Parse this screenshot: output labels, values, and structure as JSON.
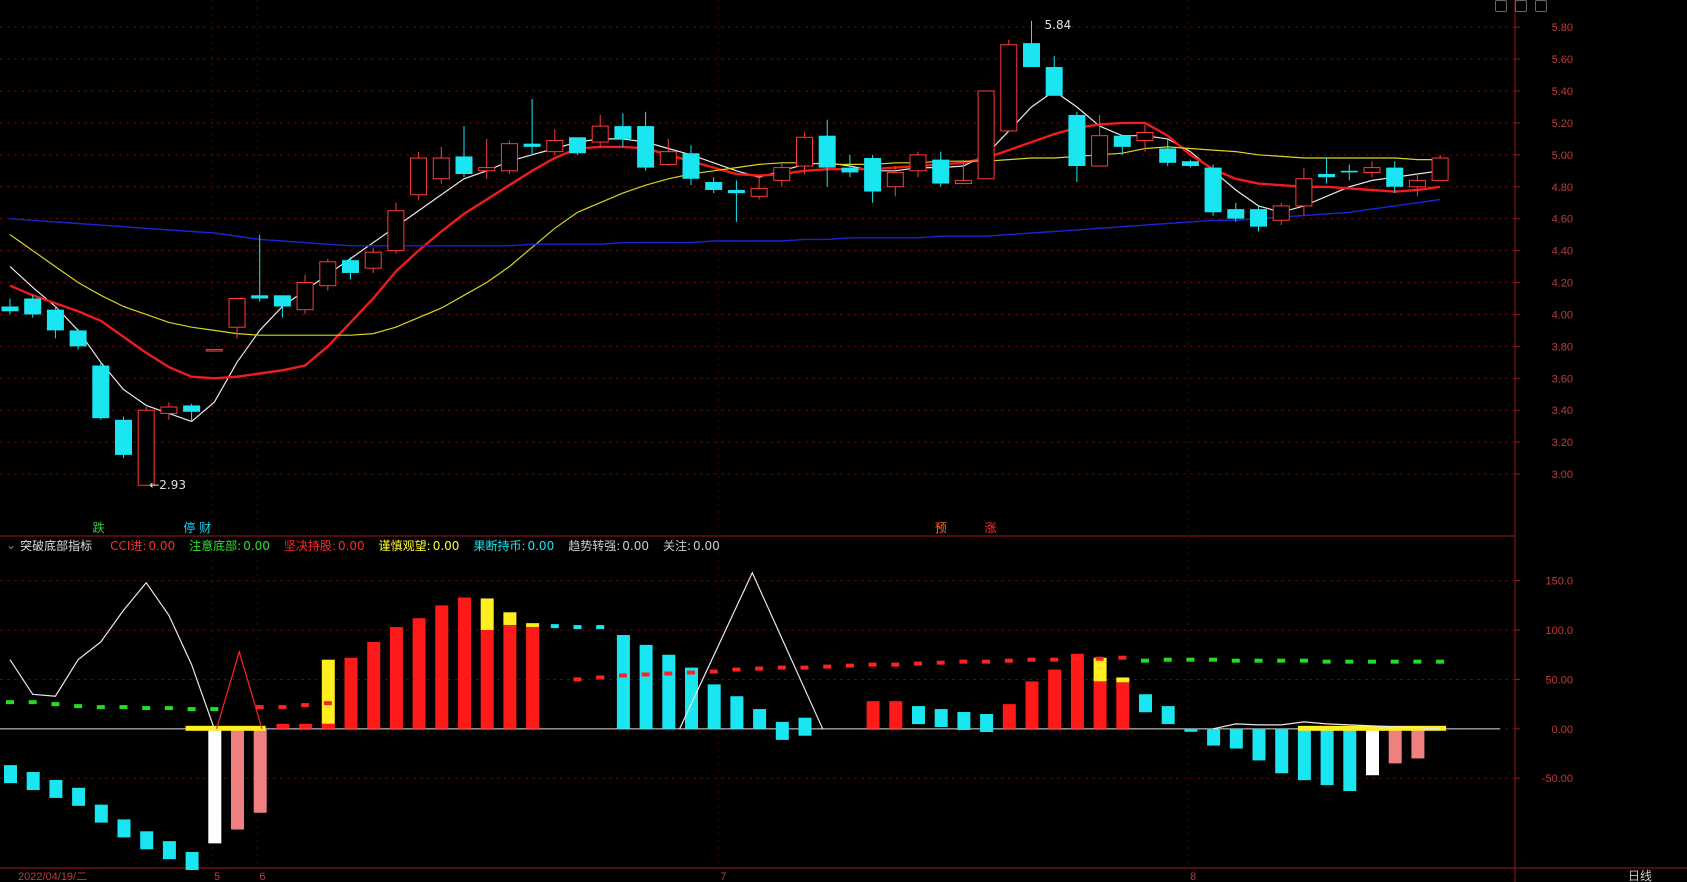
{
  "window": {
    "title_partial": ""
  },
  "period_label": "日线",
  "date_label": "2022/04/19/二",
  "month_ticks": [
    "5",
    "6",
    "7",
    "8"
  ],
  "price_axis": [
    "5.80",
    "5.60",
    "5.40",
    "5.20",
    "5.00",
    "4.80",
    "4.60",
    "4.40",
    "4.20",
    "4.00",
    "3.80",
    "3.60",
    "3.40",
    "3.20",
    "3.00"
  ],
  "indicator_axis": [
    "150.0",
    "100.0",
    "50.00",
    "0.00",
    "-50.00"
  ],
  "annotations": {
    "high": "5.84",
    "low": "←2.93"
  },
  "signals": [
    {
      "text": "跌",
      "color": "#2fd02f"
    },
    {
      "text": "停",
      "color": "#19d9f0"
    },
    {
      "text": "财",
      "color": "#19d9f0"
    },
    {
      "text": "预",
      "color": "#ff6a2a"
    },
    {
      "text": "涨",
      "color": "#ff3030"
    }
  ],
  "indicator": {
    "name": "突破底部指标",
    "fields": [
      {
        "label": "CCI进:",
        "value": "0.00",
        "color": "#ff2a2a"
      },
      {
        "label": "注意底部:",
        "value": "0.00",
        "color": "#2fe02f"
      },
      {
        "label": "坚决持股:",
        "value": "0.00",
        "color": "#ff2a2a"
      },
      {
        "label": "谨慎观望:",
        "value": "0.00",
        "color": "#ffff30"
      },
      {
        "label": "果断持币:",
        "value": "0.00",
        "color": "#19e6f0"
      },
      {
        "label": "趋势转强:",
        "value": "0.00",
        "color": "#cccccc"
      },
      {
        "label": "关注:",
        "value": "0.00",
        "color": "#cccccc"
      }
    ]
  },
  "colors": {
    "up": "#ff3b3b",
    "down": "#19e6f0",
    "ma_fast": "#e8e8e8",
    "ma_mid": "#ee1c1c",
    "ma_slow": "#d6d61e",
    "ma_long": "#1e22d0",
    "axis": "#a01818"
  },
  "chart_data": {
    "type": "candlestick",
    "ylim": [
      2.85,
      5.92
    ],
    "candles": [
      [
        4.05,
        4.02,
        4.1,
        4.0
      ],
      [
        4.1,
        4.0,
        4.12,
        3.98
      ],
      [
        4.03,
        3.9,
        4.05,
        3.85
      ],
      [
        3.9,
        3.8,
        3.91,
        3.78
      ],
      [
        3.68,
        3.35,
        3.7,
        3.34
      ],
      [
        3.34,
        3.12,
        3.36,
        3.1
      ],
      [
        2.93,
        3.4,
        3.42,
        2.93
      ],
      [
        3.38,
        3.42,
        3.45,
        3.34
      ],
      [
        3.43,
        3.39,
        3.44,
        3.33
      ],
      [
        3.78,
        3.78,
        3.78,
        3.78
      ],
      [
        3.92,
        4.1,
        4.1,
        3.85
      ],
      [
        4.12,
        4.1,
        4.5,
        4.08
      ],
      [
        4.12,
        4.05,
        4.12,
        3.98
      ],
      [
        4.03,
        4.2,
        4.25,
        4.0
      ],
      [
        4.18,
        4.33,
        4.35,
        4.15
      ],
      [
        4.34,
        4.26,
        4.36,
        4.22
      ],
      [
        4.29,
        4.39,
        4.42,
        4.26
      ],
      [
        4.4,
        4.65,
        4.7,
        4.38
      ],
      [
        4.75,
        4.98,
        5.02,
        4.72
      ],
      [
        4.85,
        4.98,
        5.05,
        4.82
      ],
      [
        4.99,
        4.88,
        5.18,
        4.86
      ],
      [
        4.9,
        4.92,
        5.1,
        4.85
      ],
      [
        4.9,
        5.07,
        5.09,
        4.88
      ],
      [
        5.07,
        5.05,
        5.35,
        5.0
      ],
      [
        5.02,
        5.09,
        5.16,
        5.0
      ],
      [
        5.11,
        5.01,
        5.1,
        5.0
      ],
      [
        5.08,
        5.18,
        5.25,
        5.05
      ],
      [
        5.18,
        5.1,
        5.26,
        5.05
      ],
      [
        5.18,
        4.92,
        5.27,
        4.9
      ],
      [
        4.94,
        5.02,
        5.1,
        4.93
      ],
      [
        5.01,
        4.85,
        5.06,
        4.81
      ],
      [
        4.83,
        4.78,
        4.86,
        4.76
      ],
      [
        4.78,
        4.76,
        4.84,
        4.58
      ],
      [
        4.74,
        4.79,
        4.87,
        4.72
      ],
      [
        4.84,
        4.92,
        4.95,
        4.8
      ],
      [
        4.93,
        5.11,
        5.14,
        4.88
      ],
      [
        5.12,
        4.92,
        5.22,
        4.8
      ],
      [
        4.92,
        4.89,
        5.0,
        4.86
      ],
      [
        4.98,
        4.77,
        5.0,
        4.7
      ],
      [
        4.8,
        4.89,
        4.93,
        4.74
      ],
      [
        4.9,
        5.0,
        5.02,
        4.86
      ],
      [
        4.97,
        4.82,
        5.02,
        4.8
      ],
      [
        4.82,
        4.84,
        4.97,
        4.82
      ],
      [
        4.85,
        5.4,
        5.4,
        4.85
      ],
      [
        5.15,
        5.69,
        5.72,
        5.15
      ],
      [
        5.7,
        5.55,
        5.84,
        5.55
      ],
      [
        5.55,
        5.37,
        5.62,
        5.37
      ],
      [
        5.25,
        4.93,
        5.27,
        4.83
      ],
      [
        4.93,
        5.12,
        5.25,
        4.93
      ],
      [
        5.12,
        5.05,
        5.12,
        5.0
      ],
      [
        5.09,
        5.14,
        5.19,
        5.02
      ],
      [
        5.04,
        4.95,
        5.1,
        4.93
      ],
      [
        4.96,
        4.93,
        4.97,
        4.92
      ],
      [
        4.92,
        4.64,
        4.94,
        4.62
      ],
      [
        4.66,
        4.6,
        4.7,
        4.58
      ],
      [
        4.66,
        4.55,
        4.68,
        4.52
      ],
      [
        4.59,
        4.68,
        4.7,
        4.56
      ],
      [
        4.68,
        4.85,
        4.92,
        4.62
      ],
      [
        4.88,
        4.86,
        4.98,
        4.82
      ],
      [
        4.9,
        4.89,
        4.94,
        4.84
      ],
      [
        4.89,
        4.92,
        4.96,
        4.86
      ],
      [
        4.92,
        4.8,
        4.96,
        4.76
      ],
      [
        4.8,
        4.84,
        4.88,
        4.74
      ],
      [
        4.84,
        4.98,
        5.0,
        4.84
      ]
    ],
    "series": [
      {
        "values": [
          4.3,
          4.17,
          4.05,
          3.9,
          3.7,
          3.53,
          3.43,
          3.38,
          3.33,
          3.45,
          3.7,
          3.9,
          4.05,
          4.15,
          4.25,
          4.35,
          4.45,
          4.55,
          4.65,
          4.75,
          4.85,
          4.9,
          4.96,
          5.0,
          5.04,
          5.08,
          5.1,
          5.1,
          5.08,
          5.04,
          5.0,
          4.95,
          4.9,
          4.86,
          4.9,
          4.94,
          4.95,
          4.93,
          4.9,
          4.9,
          4.92,
          4.92,
          4.93,
          5.0,
          5.15,
          5.3,
          5.4,
          5.3,
          5.18,
          5.12,
          5.12,
          5.1,
          5.02,
          4.9,
          4.78,
          4.68,
          4.64,
          4.68,
          4.74,
          4.8,
          4.84,
          4.86,
          4.88,
          4.9
        ]
      },
      {
        "values": [
          4.18,
          4.12,
          4.07,
          4.02,
          3.96,
          3.86,
          3.76,
          3.67,
          3.61,
          3.6,
          3.61,
          3.63,
          3.65,
          3.68,
          3.8,
          3.95,
          4.1,
          4.27,
          4.4,
          4.52,
          4.63,
          4.72,
          4.81,
          4.9,
          4.98,
          5.04,
          5.05,
          5.05,
          5.04,
          5.0,
          4.96,
          4.92,
          4.88,
          4.87,
          4.88,
          4.9,
          4.91,
          4.91,
          4.91,
          4.92,
          4.93,
          4.94,
          4.95,
          4.98,
          5.03,
          5.08,
          5.13,
          5.17,
          5.19,
          5.2,
          5.2,
          5.12,
          5.0,
          4.91,
          4.85,
          4.82,
          4.81,
          4.8,
          4.8,
          4.79,
          4.78,
          4.77,
          4.78,
          4.8
        ]
      },
      {
        "values": [
          4.5,
          4.4,
          4.3,
          4.2,
          4.12,
          4.05,
          4.0,
          3.95,
          3.92,
          3.9,
          3.88,
          3.87,
          3.87,
          3.87,
          3.87,
          3.87,
          3.88,
          3.92,
          3.98,
          4.04,
          4.12,
          4.2,
          4.3,
          4.42,
          4.54,
          4.64,
          4.7,
          4.76,
          4.81,
          4.85,
          4.88,
          4.9,
          4.92,
          4.94,
          4.95,
          4.95,
          4.94,
          4.94,
          4.94,
          4.95,
          4.95,
          4.96,
          4.96,
          4.96,
          4.97,
          4.98,
          4.98,
          4.99,
          5.0,
          5.01,
          5.04,
          5.05,
          5.04,
          5.03,
          5.02,
          5.0,
          4.99,
          4.98,
          4.98,
          4.98,
          4.98,
          4.98,
          4.97,
          4.97
        ]
      },
      {
        "values": [
          4.6,
          4.59,
          4.58,
          4.57,
          4.56,
          4.55,
          4.54,
          4.53,
          4.52,
          4.51,
          4.49,
          4.47,
          4.46,
          4.45,
          4.44,
          4.43,
          4.43,
          4.43,
          4.43,
          4.43,
          4.43,
          4.43,
          4.43,
          4.44,
          4.44,
          4.44,
          4.44,
          4.45,
          4.45,
          4.45,
          4.45,
          4.46,
          4.46,
          4.46,
          4.46,
          4.47,
          4.47,
          4.48,
          4.48,
          4.48,
          4.48,
          4.49,
          4.49,
          4.49,
          4.5,
          4.51,
          4.52,
          4.53,
          4.54,
          4.55,
          4.56,
          4.57,
          4.58,
          4.59,
          4.59,
          4.6,
          4.61,
          4.62,
          4.63,
          4.64,
          4.66,
          4.68,
          4.7,
          4.72
        ]
      }
    ],
    "indicator": {
      "ylim": [
        -145,
        175
      ],
      "bars": [
        {
          "v": -55,
          "c": "cyan"
        },
        {
          "v": -62,
          "c": "cyan"
        },
        {
          "v": -70,
          "c": "cyan"
        },
        {
          "v": -78,
          "c": "cyan"
        },
        {
          "v": -95,
          "c": "cyan"
        },
        {
          "v": -110,
          "c": "cyan"
        },
        {
          "v": -122,
          "c": "cyan"
        },
        {
          "v": -132,
          "c": "cyan"
        },
        {
          "v": -143,
          "c": "cyan"
        },
        {
          "v": -116,
          "c": "white"
        },
        {
          "v": -102,
          "c": "pink"
        },
        {
          "v": -85,
          "c": "pink"
        },
        {
          "v": 5,
          "c": "red"
        },
        {
          "v": 5,
          "c": "red"
        },
        {
          "v": 70,
          "c": "yellow",
          "r": 5
        },
        {
          "v": 72,
          "c": "red"
        },
        {
          "v": 88,
          "c": "red"
        },
        {
          "v": 103,
          "c": "red"
        },
        {
          "v": 112,
          "c": "red"
        },
        {
          "v": 125,
          "c": "red"
        },
        {
          "v": 133,
          "c": "red"
        },
        {
          "v": 132,
          "c": "yellow",
          "r": 100
        },
        {
          "v": 118,
          "c": "yellow",
          "r": 105
        },
        {
          "v": 107,
          "c": "yellow",
          "r": 103
        },
        {
          "v": 0,
          "c": "none"
        },
        {
          "v": 0,
          "c": "none"
        },
        {
          "v": 0,
          "c": "none"
        },
        {
          "v": 95,
          "c": "cyan"
        },
        {
          "v": 85,
          "c": "cyan"
        },
        {
          "v": 75,
          "c": "cyan"
        },
        {
          "v": 62,
          "c": "cyan"
        },
        {
          "v": 45,
          "c": "cyan"
        },
        {
          "v": 33,
          "c": "cyan"
        },
        {
          "v": 20,
          "c": "cyan"
        },
        {
          "v": 7,
          "c": "cyan"
        },
        {
          "v": -7,
          "c": "cyan"
        },
        {
          "v": 0,
          "c": "none"
        },
        {
          "v": 0,
          "c": "none"
        },
        {
          "v": 28,
          "c": "red"
        },
        {
          "v": 28,
          "c": "red"
        },
        {
          "v": 23,
          "c": "cyan"
        },
        {
          "v": 20,
          "c": "cyan"
        },
        {
          "v": 17,
          "c": "cyan"
        },
        {
          "v": 15,
          "c": "cyan"
        },
        {
          "v": 25,
          "c": "red"
        },
        {
          "v": 48,
          "c": "red"
        },
        {
          "v": 60,
          "c": "red"
        },
        {
          "v": 76,
          "c": "red"
        },
        {
          "v": 72,
          "c": "yellow",
          "r": 48
        },
        {
          "v": 52,
          "c": "yellow",
          "r": 47
        },
        {
          "v": 35,
          "c": "cyan"
        },
        {
          "v": 23,
          "c": "cyan"
        },
        {
          "v": -3,
          "c": "cyan"
        },
        {
          "v": -17,
          "c": "cyan"
        },
        {
          "v": -20,
          "c": "cyan"
        },
        {
          "v": -32,
          "c": "cyan"
        },
        {
          "v": -45,
          "c": "cyan"
        },
        {
          "v": -52,
          "c": "cyan"
        },
        {
          "v": -57,
          "c": "cyan"
        },
        {
          "v": -63,
          "c": "cyan"
        },
        {
          "v": -47,
          "c": "white"
        },
        {
          "v": -35,
          "c": "pink"
        },
        {
          "v": -30,
          "c": "pink"
        },
        {
          "v": 0,
          "c": "none"
        }
      ],
      "cci_line": [
        70,
        35,
        33,
        70,
        88,
        120,
        148,
        115,
        65,
        0,
        0,
        0,
        0,
        0,
        0,
        0,
        0,
        0,
        0,
        0,
        0,
        0,
        0,
        0,
        0,
        0,
        0,
        0,
        0,
        0,
        0,
        0,
        0,
        0,
        0,
        0,
        0,
        0,
        0,
        0,
        0,
        0,
        0,
        0,
        0,
        0,
        0,
        0,
        0,
        0,
        0,
        0,
        0,
        0,
        5,
        4,
        4,
        7,
        5,
        4,
        3,
        2,
        1,
        0
      ],
      "green_dashes": [
        [
          0,
          27
        ],
        [
          1,
          27
        ],
        [
          2,
          25
        ],
        [
          3,
          23
        ],
        [
          4,
          22
        ],
        [
          5,
          22
        ],
        [
          6,
          21
        ],
        [
          7,
          21
        ],
        [
          8,
          20
        ],
        [
          9,
          20
        ],
        [
          50,
          69
        ],
        [
          51,
          70
        ],
        [
          52,
          70
        ],
        [
          53,
          70
        ],
        [
          54,
          69
        ],
        [
          55,
          69
        ],
        [
          56,
          69
        ],
        [
          57,
          69
        ],
        [
          58,
          68
        ],
        [
          59,
          68
        ],
        [
          60,
          68
        ],
        [
          61,
          68
        ],
        [
          62,
          68
        ],
        [
          63,
          68
        ]
      ],
      "red_dashes": [
        [
          11,
          22
        ],
        [
          12,
          22
        ],
        [
          13,
          24
        ],
        [
          14,
          26
        ],
        [
          25,
          50
        ],
        [
          26,
          52
        ],
        [
          27,
          54
        ],
        [
          28,
          55
        ],
        [
          29,
          56
        ],
        [
          30,
          57
        ],
        [
          31,
          58
        ],
        [
          32,
          60
        ],
        [
          33,
          61
        ],
        [
          34,
          62
        ],
        [
          35,
          62
        ],
        [
          36,
          63
        ],
        [
          37,
          64
        ],
        [
          38,
          65
        ],
        [
          39,
          65
        ],
        [
          40,
          66
        ],
        [
          41,
          67
        ],
        [
          42,
          68
        ],
        [
          43,
          68
        ],
        [
          44,
          69
        ],
        [
          45,
          70
        ],
        [
          46,
          70
        ],
        [
          47,
          71
        ],
        [
          48,
          71
        ],
        [
          49,
          72
        ]
      ],
      "cyan_dashes": [
        [
          24,
          104
        ],
        [
          25,
          103
        ],
        [
          26,
          103
        ]
      ],
      "yellow_base": [
        [
          8,
          11
        ],
        [
          57,
          63
        ]
      ],
      "cci_peak": {
        "i": 32.7,
        "v": 158
      },
      "red_triangle": {
        "i": 10.1,
        "v": 78
      }
    }
  }
}
